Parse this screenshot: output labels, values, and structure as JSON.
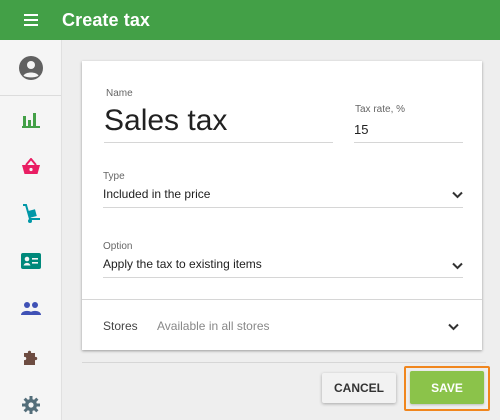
{
  "header": {
    "title": "Create tax"
  },
  "sidebar": {
    "items": [
      {
        "name": "avatar",
        "icon": "account-circle-icon",
        "color": "#616161"
      },
      {
        "name": "reports",
        "icon": "bar-chart-icon",
        "color": "#43a047"
      },
      {
        "name": "items",
        "icon": "basket-icon",
        "color": "#e91e63"
      },
      {
        "name": "inventory",
        "icon": "hand-truck-icon",
        "color": "#0097a7"
      },
      {
        "name": "employees",
        "icon": "id-card-icon",
        "color": "#00897b"
      },
      {
        "name": "customers",
        "icon": "people-icon",
        "color": "#3f51b5"
      },
      {
        "name": "integrations",
        "icon": "puzzle-icon",
        "color": "#6d4c41"
      },
      {
        "name": "settings",
        "icon": "gear-icon",
        "color": "#546e7a"
      }
    ]
  },
  "form": {
    "name_label": "Name",
    "name_value": "Sales tax",
    "rate_label": "Tax rate, %",
    "rate_value": "15",
    "type_label": "Type",
    "type_value": "Included in the price",
    "option_label": "Option",
    "option_value": "Apply the tax to existing items",
    "stores_label": "Stores",
    "stores_value": "Available in all stores"
  },
  "actions": {
    "cancel_label": "CANCEL",
    "save_label": "SAVE"
  },
  "colors": {
    "header": "#43a047",
    "save": "#8bc34a",
    "highlight": "#f0861e"
  }
}
